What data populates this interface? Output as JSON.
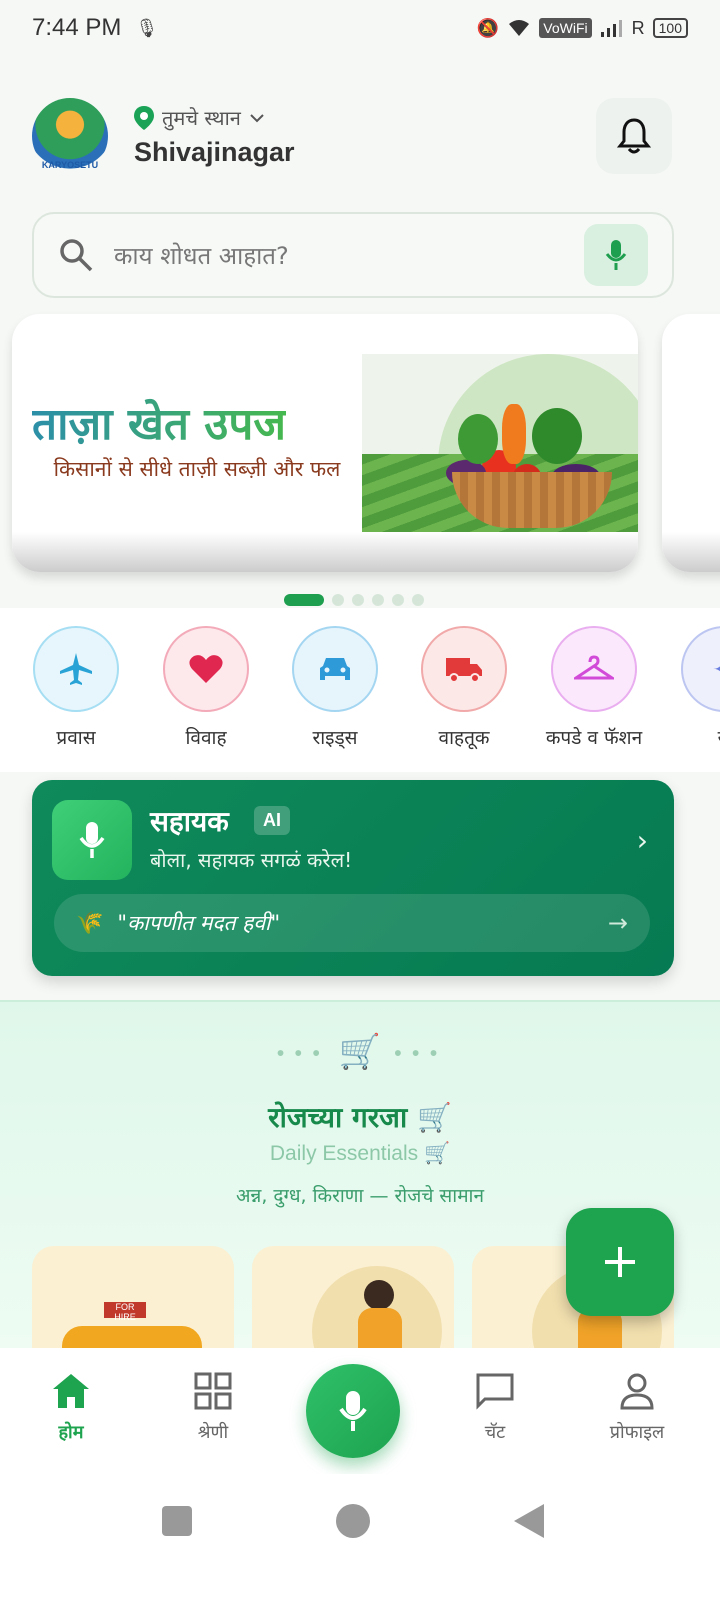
{
  "status_bar": {
    "time": "7:44 PM",
    "network_label": "VoWiFi",
    "roaming": "R",
    "battery": "100"
  },
  "header": {
    "logo_text": "KARYOSETU",
    "location_label": "तुमचे स्थान",
    "location_city": "Shivajinagar"
  },
  "search": {
    "placeholder": "काय शोधत आहात?"
  },
  "banner": {
    "title": "ताज़ा खेत उपज",
    "subtitle": "किसानों से सीधे ताज़ी सब्ज़ी और फल",
    "active_slide_index": 0,
    "total_slides": 6
  },
  "categories": [
    {
      "label": "प्रवास",
      "icon": "airplane-icon",
      "color": "#29a3d6"
    },
    {
      "label": "विवाह",
      "icon": "heart-icon",
      "color": "#e0274f"
    },
    {
      "label": "राइड्स",
      "icon": "car-icon",
      "color": "#2e9ad8"
    },
    {
      "label": "वाहतूक",
      "icon": "truck-icon",
      "color": "#e23a3a"
    },
    {
      "label": "कपडे व फॅशन",
      "icon": "hanger-icon",
      "color": "#d24bd8"
    },
    {
      "label": "स",
      "icon": "more-icon",
      "color": "#6a7fe0"
    }
  ],
  "assistant": {
    "name": "सहायक",
    "badge": "AI",
    "tagline": "बोला, सहायक सगळं करेल!",
    "prompt": "\"कापणीत मदत हवी\""
  },
  "essentials": {
    "title": "रोजच्या गरजा 🛒",
    "title_en": "Daily Essentials 🛒",
    "description": "अन्न, दुग्ध, किराणा — रोजचे सामान",
    "card_1_sign": "FOR HIRE"
  },
  "bottom_nav": [
    {
      "label": "होम",
      "active": true
    },
    {
      "label": "श्रेणी",
      "active": false
    },
    {
      "label": "चॅट",
      "active": false
    },
    {
      "label": "प्रोफाइल",
      "active": false
    }
  ],
  "colors": {
    "primary": "#1ea34f",
    "assistant_bg": "#0f8a5a"
  }
}
